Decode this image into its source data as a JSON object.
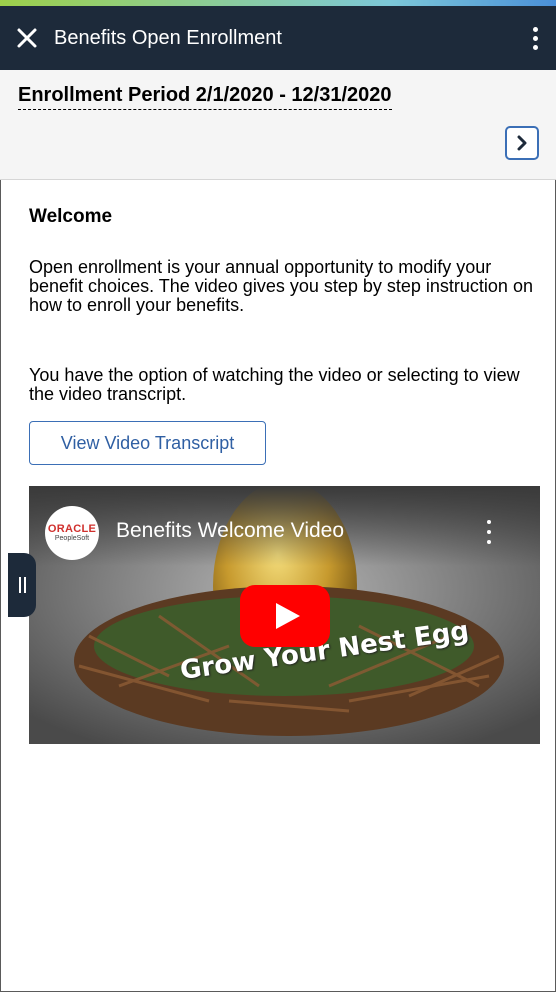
{
  "header": {
    "title": "Benefits Open Enrollment",
    "close_icon": "close-icon",
    "menu_icon": "vertical-ellipsis-icon",
    "background_color": "#1d2a3a",
    "accent_gradient": [
      "#9dd04a",
      "#7dc8d8",
      "#4a90d9"
    ]
  },
  "subheader": {
    "period_title": "Enrollment Period 2/1/2020 - 12/31/2020",
    "next_icon": "chevron-right-icon"
  },
  "content": {
    "heading": "Welcome",
    "paragraph1": "Open enrollment is your annual opportunity to modify your benefit choices. The video gives you step by step instruction on how to enroll your benefits.",
    "paragraph2": "You have the option of watching the video or selecting to view the video transcript.",
    "transcript_button_label": "View Video Transcript"
  },
  "video": {
    "channel_logo_line1": "ORACLE",
    "channel_logo_line2": "PeopleSoft",
    "title": "Benefits Welcome Video",
    "caption": "Grow Your Nest Egg",
    "play_icon": "youtube-play-icon",
    "menu_icon": "vertical-ellipsis-icon",
    "play_color": "#ff0000"
  },
  "side_handle": {
    "icon": "pause-bars-icon"
  }
}
